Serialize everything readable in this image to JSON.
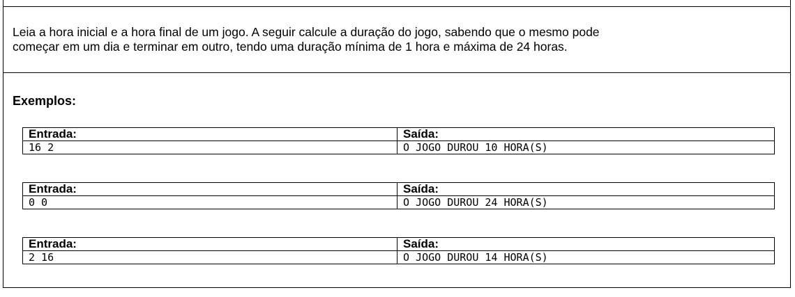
{
  "problem": {
    "description_line1": "Leia a hora inicial e a hora final de um jogo. A seguir calcule a duração do jogo, sabendo que o mesmo pode",
    "description_line2": "começar em um dia e terminar em outro, tendo uma duração mínima de 1 hora e máxima de 24 horas."
  },
  "examples": {
    "heading": "Exemplos:",
    "input_header": "Entrada:",
    "output_header": "Saída:",
    "cases": [
      {
        "input": "16 2",
        "output": "O JOGO DUROU 10 HORA(S)"
      },
      {
        "input": "0 0",
        "output": "O JOGO DUROU 24 HORA(S)"
      },
      {
        "input": "2 16",
        "output": "O JOGO DUROU 14 HORA(S)"
      }
    ]
  }
}
